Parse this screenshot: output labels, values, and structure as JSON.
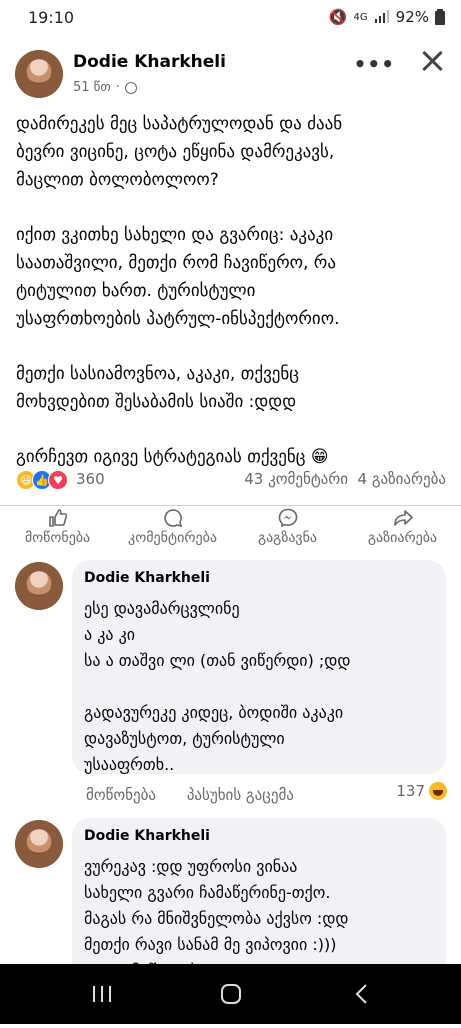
{
  "status_bar": {
    "time": "19:10",
    "network": "4G",
    "battery": "92%"
  },
  "post": {
    "author": "Dodie Kharkheli",
    "time": "51 წთ",
    "separator": "·",
    "paragraphs": [
      "დამირეკეს მეც საპატრულოდან და ძაან\nბევრი ვიცინე, ცოტა ეწყინა დამრეკავს,\nმაცლით ბოლობოლოო?",
      "იქით ვკითხე სახელი და გვარიც: აკაკი\nსაათაშვილი, მეთქი რომ ჩავიწერო, რა\nტიტულით ხართ. ტურისტული\nუსაფრთხოების პატრულ-ინსპექტორიო.",
      "მეთქი სასიამოვნოა, აკაკი, თქვენც\nმოხვდებით შესაბამის სიაში :დდდ",
      "გირჩევთ იგივე სტრატეგიას თქვენც 😁"
    ],
    "reactions_count": "360",
    "comments_count": "43 კომენტარი",
    "shares_count": "4 გაზიარება"
  },
  "actions": {
    "like": "მოწონება",
    "comment": "კომენტირება",
    "send": "გაგზავნა",
    "share": "გაზიარება"
  },
  "comments": [
    {
      "author": "Dodie Kharkheli",
      "text": "ესე დავამარცვლინე\nა კა კი\nსა ა თაშვი ლი (თან ვიწერდი) ;დდ\n\nგადავურეკე კიდეც, ბოდიში აკაკი\nდავაზუსტოთ, ტურისტული\nუსააფრთხ..",
      "like_label": "მოწონება",
      "reply_label": "პასუხის გაცემა",
      "reaction_count": "137"
    },
    {
      "author": "Dodie Kharkheli",
      "text": "ვურეკავ :დდ უფროსი ვინაა\nსახელი გვარი ჩამაწერინე-თქო.\nმაგას რა მნიშვნელობა აქვსო :დდ\nმეთქი რავი სანამ მე ვიპოვიი :)))\nდა დამიწყეთქო"
    }
  ]
}
